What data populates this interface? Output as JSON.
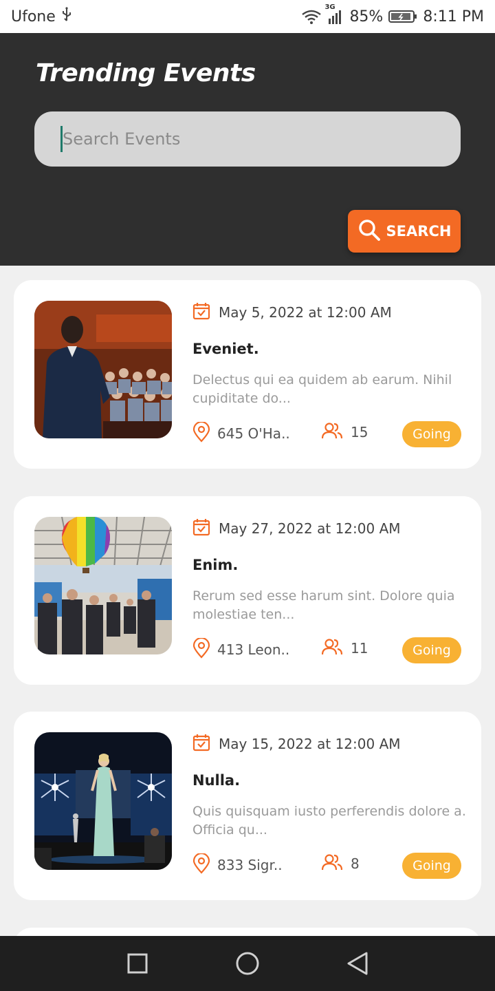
{
  "status_bar": {
    "carrier": "Ufone",
    "network": "3G",
    "battery": "85%",
    "time": "8:11 PM"
  },
  "header": {
    "title": "Trending Events",
    "search_placeholder": "Search Events",
    "search_button": "SEARCH"
  },
  "events": [
    {
      "date": "May 5, 2022 at 12:00 AM",
      "title": "Eveniet.",
      "description": "Delectus qui ea quidem ab earum. Nihil cupiditate do...",
      "location": "645 O'Ha..",
      "attendees": "15",
      "status": "Going",
      "image": "conference-speaker-photo"
    },
    {
      "date": "May 27, 2022 at 12:00 AM",
      "title": "Enim.",
      "description": "Rerum sed esse harum sint. Dolore quia molestiae ten...",
      "location": "413 Leon..",
      "attendees": "11",
      "status": "Going",
      "image": "expo-hall-balloon-photo"
    },
    {
      "date": "May 15, 2022 at 12:00 AM",
      "title": "Nulla.",
      "description": "Quis quisquam iusto perferendis dolore a. Officia qu...",
      "location": "833 Sigr..",
      "attendees": "8",
      "status": "Going",
      "image": "fashion-runway-photo"
    }
  ],
  "colors": {
    "header_bg": "#2f2f2f",
    "accent": "#f36a24",
    "going_badge": "#f8b133",
    "page_bg": "#f0f0f0"
  }
}
